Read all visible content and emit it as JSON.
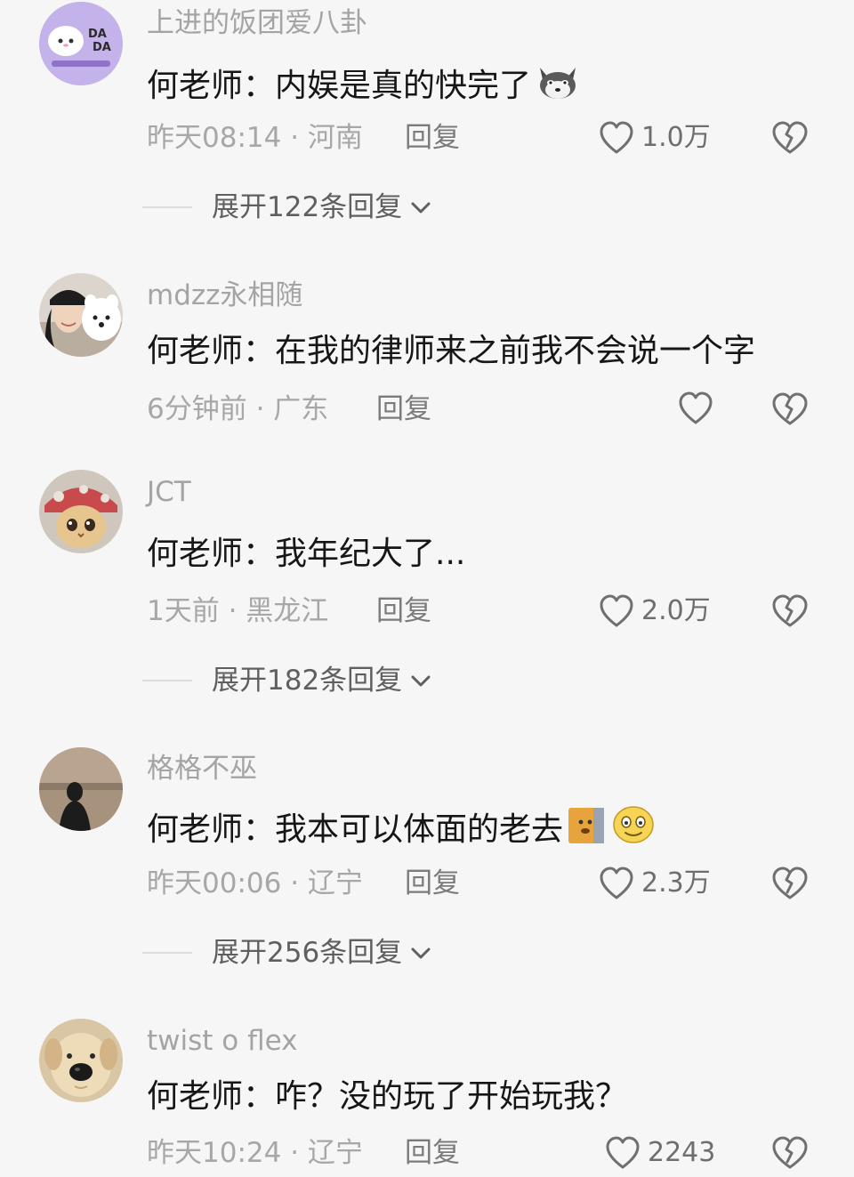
{
  "comments": [
    {
      "username": "上进的饭团爱八卦",
      "text": "何老师：内娱是真的快完了",
      "emoji": "dog-emoji",
      "time_location": "昨天08:14 · 河南",
      "reply_label": "回复",
      "likes": "1.0万",
      "expand_label": "展开122条回复",
      "avatar": "dada-logo-avatar"
    },
    {
      "username": "mdzz永相随",
      "text": "何老师：在我的律师来之前我不会说一个字",
      "time_location": "6分钟前 · 广东",
      "reply_label": "回复",
      "likes": "",
      "avatar": "girl-with-dog-avatar"
    },
    {
      "username": "JCT",
      "text": "何老师：我年纪大了...",
      "time_location": "1天前 · 黑龙江",
      "reply_label": "回复",
      "likes": "2.0万",
      "expand_label": "展开182条回复",
      "avatar": "cat-in-hat-avatar"
    },
    {
      "username": "格格不巫",
      "text": "何老师：我本可以体面的老去",
      "emoji": "doge-and-smile-emoji",
      "time_location": "昨天00:06 · 辽宁",
      "reply_label": "回复",
      "likes": "2.3万",
      "expand_label": "展开256条回复",
      "avatar": "silhouette-avatar"
    },
    {
      "username": "twist o flex",
      "text": "何老师：咋？没的玩了开始玩我？",
      "time_location": "昨天10:24 · 辽宁",
      "reply_label": "回复",
      "likes": "2243",
      "avatar": "puppy-avatar"
    }
  ],
  "avatar_logo_text": "DA DA",
  "colors": {
    "background": "#f6f6f6",
    "text_primary": "#161616",
    "text_secondary": "#a4a4a4",
    "icon": "#6e6e6e"
  }
}
